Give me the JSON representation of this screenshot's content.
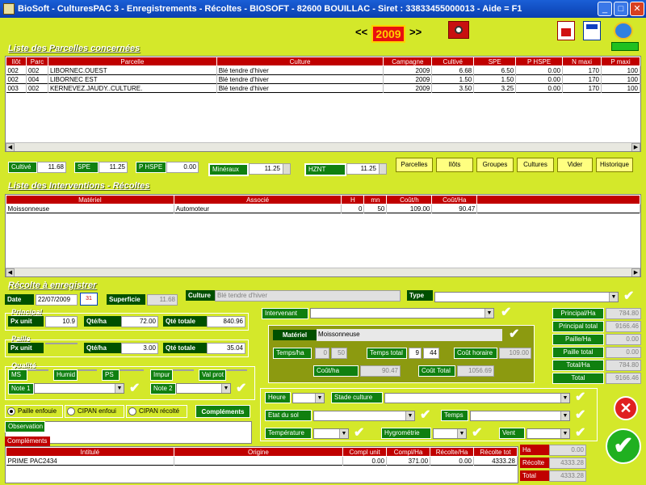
{
  "window": {
    "title": "BioSoft - CulturesPAC 3 - Enregistrements - Récoltes    - BIOSOFT - 82600 BOUILLAC - Siret : 33833455000013 - Aide = F1"
  },
  "topbar": {
    "prev": "<<",
    "year": "2009",
    "next": ">>"
  },
  "parcelles": {
    "title": "Liste des Parcelles concernées",
    "headers": [
      "Ilôt",
      "Parc",
      "Parcelle",
      "Culture",
      "Campagne",
      "Cultivé",
      "SPE",
      "P HSPE",
      "N maxi",
      "P maxi"
    ],
    "rows": [
      [
        "002",
        "002",
        "LIBORNEC.OUEST",
        "Blé tendre d'hiver",
        "2009",
        "6.68",
        "6.50",
        "0.00",
        "170",
        "100"
      ],
      [
        "002",
        "004",
        "LIBORNEC EST",
        "Blé tendre d'hiver",
        "2009",
        "1.50",
        "1.50",
        "0.00",
        "170",
        "100"
      ],
      [
        "003",
        "002",
        "KERNEVEZ.JAUDY..CULTURE.",
        "Blé tendre d'hiver",
        "2009",
        "3.50",
        "3.25",
        "0.00",
        "170",
        "100"
      ]
    ]
  },
  "totals": {
    "cultive_label": "Cultivé",
    "cultive": "11.68",
    "spe_label": "SPE",
    "spe": "11.25",
    "phspe_label": "P HSPE",
    "phspe": "0.00",
    "mineraux_label": "Minéraux",
    "mineraux": "11.25",
    "hznt_label": "HZNT",
    "hznt": "11.25"
  },
  "buttons": {
    "parcelles": "Parcelles",
    "ilots": "Ilôts",
    "groupes": "Groupes",
    "cultures": "Cultures",
    "vider": "Vider",
    "historique": "Historique"
  },
  "interventions": {
    "title": "Liste des Interventions - Récoltes",
    "headers": [
      "Matériel",
      "Associé",
      "H",
      "mn",
      "Coût/h",
      "Coût/Ha"
    ],
    "rows": [
      [
        "Moissonneuse",
        "Automoteur",
        "0",
        "50",
        "109.00",
        "90.47"
      ]
    ]
  },
  "recolte": {
    "title": "Récolte à enregistrer",
    "date_label": "Date",
    "date": "22/07/2009",
    "superficie_label": "Superficie",
    "superficie": "11.68",
    "culture_label": "Culture",
    "culture": "Blé tendre d'hiver",
    "type_label": "Type"
  },
  "principal": {
    "title": "Principal",
    "px_unit_label": "Px unit",
    "px_unit": "10.9",
    "qte_ha_label": "Qté/ha",
    "qte_ha": "72.00",
    "qte_totale_label": "Qté totale",
    "qte_totale": "840.96"
  },
  "paille": {
    "title": "Paille",
    "px_unit_label": "Px unit",
    "px_unit": "",
    "qte_ha_label": "Qté/ha",
    "qte_ha": "3.00",
    "qte_totale_label": "Qté totale",
    "qte_totale": "35.04"
  },
  "qualite": {
    "title": "Qualité",
    "ms": "MS",
    "humid": "Humid",
    "ps": "PS",
    "impur": "Impur",
    "val_prot": "Val prot",
    "note1": "Note 1",
    "note2": "Note 2"
  },
  "options": {
    "paille_enfouie": "Paille enfouie",
    "cipan_enfoui": "CIPAN enfoui",
    "cipan_recolte": "CIPAN récolté",
    "complements_btn": "Compléments"
  },
  "observation_label": "Observation",
  "intervenant_label": "Intervenant",
  "materiel": {
    "label": "Matériel",
    "value": "Moissonneuse",
    "temps_ha_label": "Temps/ha",
    "temps_ha_h": "0",
    "temps_ha_mn": "50",
    "temps_total_label": "Temps total",
    "temps_total_h": "9",
    "temps_total_mn": "44",
    "cout_horaire_label": "Coût horaire",
    "cout_horaire": "109.00",
    "cout_ha_label": "Coût/ha",
    "cout_ha": "90.47",
    "cout_total_label": "Coût Total",
    "cout_total": "1056.69"
  },
  "summary": {
    "principal_ha_label": "Principal/Ha",
    "principal_ha": "784.80",
    "principal_total_label": "Principal total",
    "principal_total": "9166.46",
    "paille_ha_label": "Paille/Ha",
    "paille_ha": "0.00",
    "paille_total_label": "Paille total",
    "paille_total": "0.00",
    "total_ha_label": "Total/Ha",
    "total_ha": "784.80",
    "total_label": "Total",
    "total": "9166.46"
  },
  "meteo": {
    "heure": "Heure",
    "stade": "Stade culture",
    "etat_sol": "Etat du sol",
    "temps": "Temps",
    "temperature": "Température",
    "hygrometrie": "Hygrométrie",
    "vent": "Vent"
  },
  "complements": {
    "tab_label": "Compléments",
    "headers": [
      "Intitulé",
      "Origine",
      "Compl unit",
      "Compl/Ha",
      "Récolte/Ha",
      "Récolte tot"
    ],
    "rows": [
      [
        "PRIME PAC2434",
        "",
        "0.00",
        "371.00",
        "0.00",
        "4333.28"
      ]
    ],
    "ha_label": "Ha",
    "ha": "0.00",
    "recolte_label": "Récolte",
    "recolte": "4333.28",
    "total_label": "Total",
    "total": "4333.28"
  },
  "icons": {
    "cancel": "close-icon",
    "validate": "checkmark-icon"
  },
  "colors": {
    "background": "#d4e82a",
    "header_red": "#c00000",
    "label_green": "#108010",
    "title_blue": "#0a3fb0"
  }
}
